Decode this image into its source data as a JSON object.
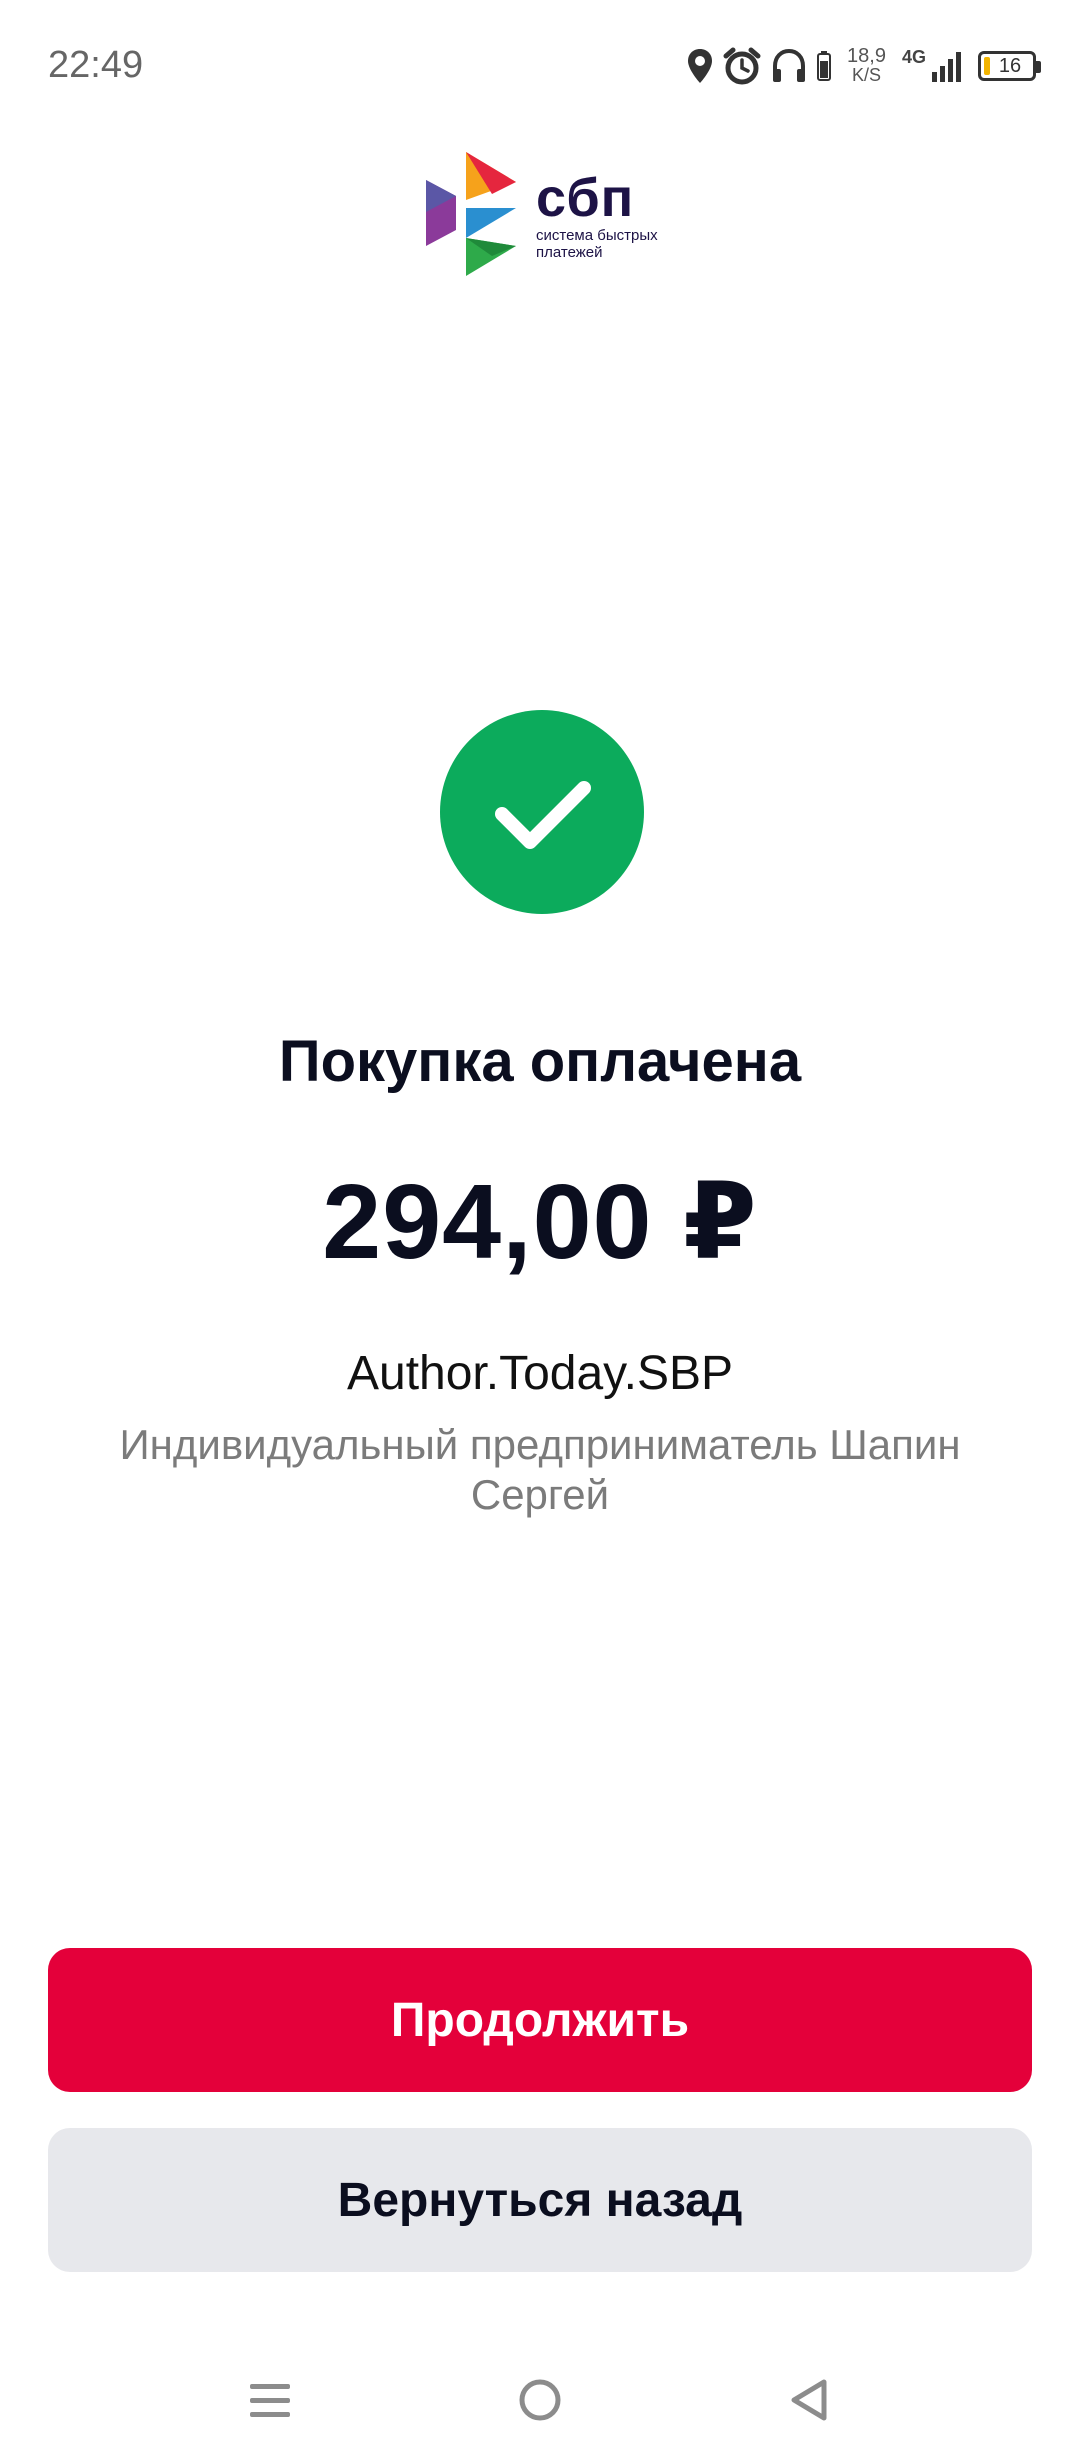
{
  "status_bar": {
    "time": "22:49",
    "net_speed_value": "18,9",
    "net_speed_unit": "K/S",
    "network_type": "4G",
    "battery_level": "16",
    "icons": [
      "location-icon",
      "alarm-icon",
      "headphones-icon",
      "headphone-battery-icon",
      "signal-icon",
      "battery-icon"
    ]
  },
  "logo": {
    "name": "сбп",
    "tagline": "система быстрых платежей",
    "colors": [
      "#f6a21b",
      "#e5263e",
      "#8b3a9a",
      "#3aa0dc",
      "#2eaa4a",
      "#1d1346"
    ]
  },
  "payment": {
    "status_icon": "checkmark-icon",
    "status_color": "#0cab5c",
    "title": "Покупка оплачена",
    "amount": "294,00 ₽",
    "merchant_name": "Author.Today.SBP",
    "merchant_description": "Индивидуальный предприниматель Шапин Сергей"
  },
  "actions": {
    "continue_label": "Продолжить",
    "continue_color": "#e4003a",
    "back_label": "Вернуться назад"
  },
  "nav_bar": {
    "icons": [
      "menu-icon",
      "home-icon",
      "back-icon"
    ]
  }
}
